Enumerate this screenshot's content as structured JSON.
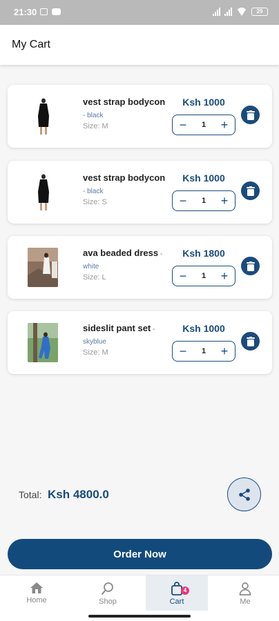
{
  "status_bar": {
    "time": "21:30",
    "battery": "29"
  },
  "header": {
    "title": "My Cart"
  },
  "cart": {
    "items": [
      {
        "name": "vest strap bodycon",
        "separator": " - ",
        "color": "black",
        "size": "Size: M",
        "price": "Ksh 1000",
        "quantity": "1"
      },
      {
        "name": "vest strap bodycon",
        "separator": " - ",
        "color": "black",
        "size": "Size: S",
        "price": "Ksh 1000",
        "quantity": "1"
      },
      {
        "name": "ava beaded dress",
        "separator": " - ",
        "color": "white",
        "size": "Size: L",
        "price": "Ksh 1800",
        "quantity": "1"
      },
      {
        "name": "sideslit pant set",
        "separator": " - ",
        "color": "skyblue",
        "size": "Size: M",
        "price": "Ksh 1000",
        "quantity": "1"
      }
    ]
  },
  "summary": {
    "total_label": "Total:",
    "total_value": "Ksh 4800.0"
  },
  "actions": {
    "order_label": "Order Now",
    "share_icon": "share-icon"
  },
  "nav": {
    "items": [
      {
        "label": "Home",
        "icon": "home-icon"
      },
      {
        "label": "Shop",
        "icon": "search-icon"
      },
      {
        "label": "Cart",
        "icon": "bag-icon",
        "badge": "4",
        "active": true
      },
      {
        "label": "Me",
        "icon": "person-icon"
      }
    ]
  },
  "colors": {
    "primary": "#134a7c",
    "badge": "#e5397a",
    "background": "#f6f6f7"
  }
}
